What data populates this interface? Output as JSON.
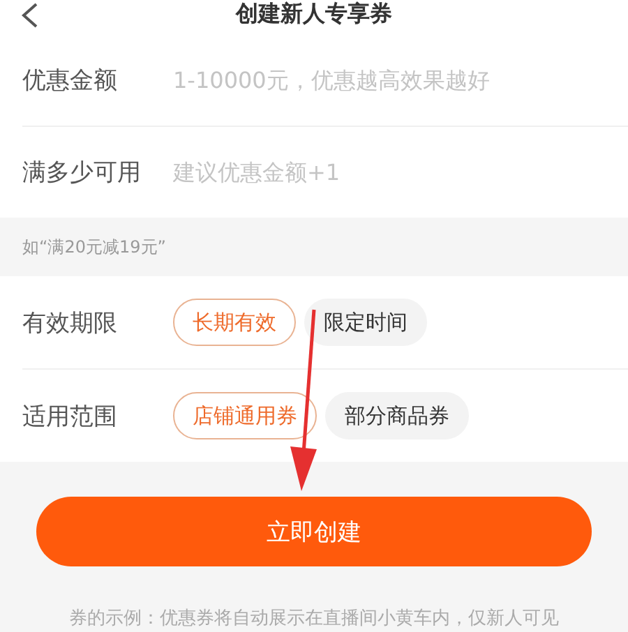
{
  "header": {
    "title": "创建新人专享券"
  },
  "fields": [
    {
      "label": "优惠金额",
      "placeholder": "1-10000元，优惠越高效果越好"
    },
    {
      "label": "满多少可用",
      "placeholder": "建议优惠金额+1"
    }
  ],
  "hint": "如“满20元减19元”",
  "options": [
    {
      "label": "有效期限",
      "choices": [
        {
          "label": "长期有效",
          "selected": true
        },
        {
          "label": "限定时间",
          "selected": false
        }
      ]
    },
    {
      "label": "适用范围",
      "choices": [
        {
          "label": "店铺通用券",
          "selected": true
        },
        {
          "label": "部分商品券",
          "selected": false
        }
      ]
    }
  ],
  "create_button": "立即创建",
  "footer_note": "券的示例：优惠券将自动展示在直播间小黄车内，仅新人可见"
}
